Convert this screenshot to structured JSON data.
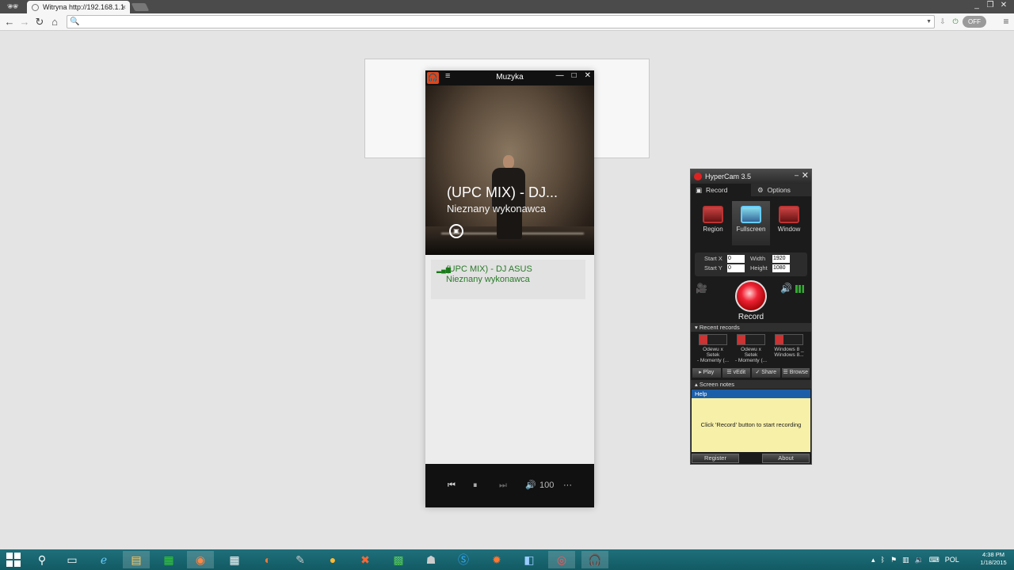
{
  "browser": {
    "tab_title": "Witryna http://192.168.1.1",
    "tab_close": "×",
    "address_value": "",
    "off_toggle": "OFF",
    "menu_glyph": "≡",
    "win_min": "_",
    "win_max": "❐",
    "win_close": "✕"
  },
  "music_app": {
    "title": "Muzyka",
    "menu_glyph": "≡",
    "logo_glyph": "🎧",
    "minimize": "—",
    "maximize": "□",
    "close": "✕",
    "now_playing": {
      "title": "(UPC MIX) - DJ...",
      "artist": "Nieznany wykonawca"
    },
    "playlist": [
      {
        "title": "(UPC MIX) - DJ ASUS",
        "artist": "Nieznany wykonawca"
      }
    ],
    "transport": {
      "prev": "⏮",
      "pause": "⏸",
      "next": "⏭",
      "volume_icon": "🔊",
      "volume": "100",
      "more": "···"
    }
  },
  "hypercam": {
    "title": "HyperCam 3.5",
    "min": "–",
    "close": "✕",
    "tabs": {
      "record": "Record",
      "options": "Options"
    },
    "modes": {
      "region": "Region",
      "fullscreen": "Fullscreen",
      "window": "Window"
    },
    "coords": {
      "start_x_label": "Start X",
      "start_x": "0",
      "start_y_label": "Start Y",
      "start_y": "0",
      "width_label": "Width",
      "width": "1920",
      "height_label": "Height",
      "height": "1080"
    },
    "record_label": "Record",
    "recent_header": "Recent records",
    "recents": [
      {
        "line1": "Odewu x Setek",
        "line2": "- Momenty (..."
      },
      {
        "line1": "Odewu x Setek",
        "line2": "- Momenty (..."
      },
      {
        "line1": "Windows 8 _",
        "line2": "Windows 8..."
      }
    ],
    "actions": {
      "play": "▸ Play",
      "edit": "☰ vEdit",
      "share": "✓ Share",
      "browse": "☰ Browse"
    },
    "notes_header": "Screen notes",
    "help_label": "Help",
    "notes_text": "Click 'Record' button to start recording",
    "register": "Register",
    "about": "About"
  },
  "taskbar": {
    "tray_lang": "POL",
    "time": "4:38 PM",
    "date": "1/18/2015"
  }
}
